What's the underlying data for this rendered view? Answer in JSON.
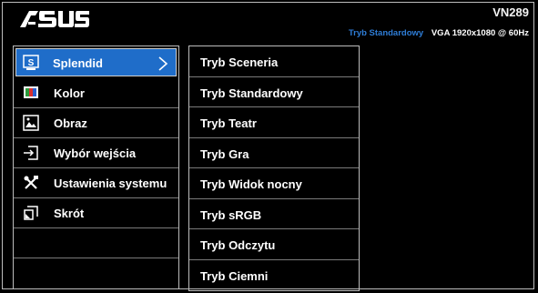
{
  "brand": {
    "logo_text": "/ISUS",
    "model": "VN289"
  },
  "status": {
    "mode": "Tryb Standardowy",
    "signal": "VGA  1920x1080 @ 60Hz"
  },
  "left_menu": {
    "items": [
      {
        "label": "Splendid",
        "icon": "splendid-icon"
      },
      {
        "label": "Kolor",
        "icon": "color-icon"
      },
      {
        "label": "Obraz",
        "icon": "image-icon"
      },
      {
        "label": "Wybór wejścia",
        "icon": "input-select-icon"
      },
      {
        "label": "Ustawienia systemu",
        "icon": "tools-icon"
      },
      {
        "label": "Skrót",
        "icon": "shortcut-icon"
      }
    ]
  },
  "right_menu": {
    "items": [
      "Tryb Sceneria",
      "Tryb Standardowy",
      "Tryb Teatr",
      "Tryb Gra",
      "Tryb Widok nocny",
      "Tryb sRGB",
      "Tryb Odczytu",
      "Tryb Ciemni"
    ]
  },
  "colors": {
    "accent": "#1f6dc9",
    "status_mode": "#2e7dd7",
    "background": "#000000"
  }
}
